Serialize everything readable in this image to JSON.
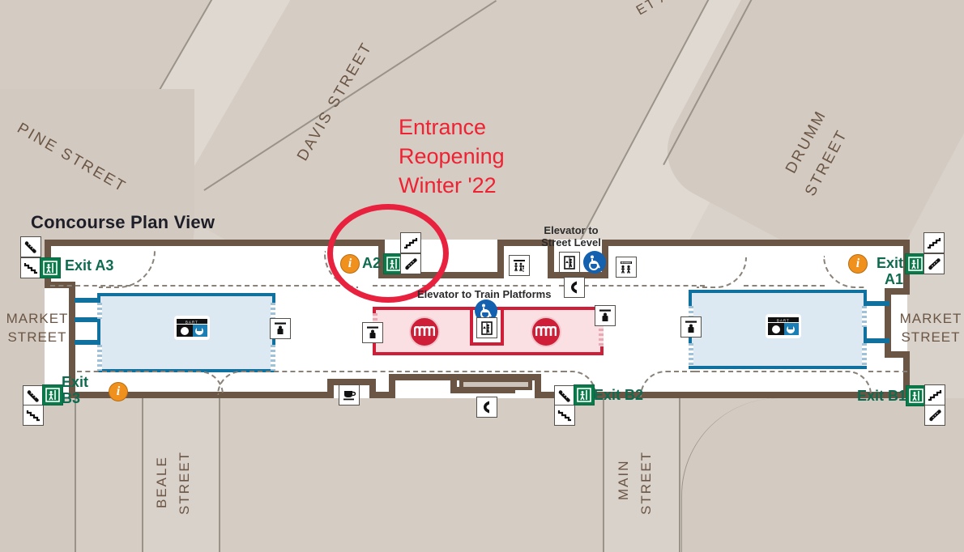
{
  "map": {
    "title": "Concourse Plan View",
    "alert": {
      "line1": "Entrance",
      "line2": "Reopening",
      "line3": "Winter '22",
      "color": "#ee2233"
    },
    "streets": [
      {
        "name": "PINE STREET",
        "text": "PINE  STREET"
      },
      {
        "name": "DAVIS STREET",
        "text": "DAVIS  STREET"
      },
      {
        "name": "DRUMM STREET",
        "text": "DRUMM"
      },
      {
        "name": "DRUMM STREET 2",
        "text": "STREET"
      },
      {
        "name": "BEALE STREET",
        "text": "BEALE"
      },
      {
        "name": "BEALE STREET 2",
        "text": "STREET"
      },
      {
        "name": "MAIN STREET",
        "text": "MAIN"
      },
      {
        "name": "MAIN STREET 2",
        "text": "STREET"
      },
      {
        "name": "MARKET STREET LEFT 1",
        "text": "MARKET"
      },
      {
        "name": "MARKET STREET LEFT 2",
        "text": "STREET"
      },
      {
        "name": "MARKET STREET RIGHT 1",
        "text": "MARKET"
      },
      {
        "name": "MARKET STREET RIGHT 2",
        "text": "STREET"
      },
      {
        "name": "CLIPPED TOP",
        "text": "ET  A"
      }
    ],
    "exits": [
      {
        "id": "A3",
        "label": "Exit A3"
      },
      {
        "id": "A2",
        "label": "A2"
      },
      {
        "id": "A1_l1",
        "label": "Exit"
      },
      {
        "id": "A1_l2",
        "label": "A1"
      },
      {
        "id": "B3_l1",
        "label": "Exit"
      },
      {
        "id": "B3_l2",
        "label": "B3"
      },
      {
        "id": "B2",
        "label": "Exit B2"
      },
      {
        "id": "B1",
        "label": "Exit B1"
      }
    ],
    "callouts": [
      {
        "id": "elev-street",
        "line1": "Elevator to",
        "line2": "Street Level"
      },
      {
        "id": "elev-platform",
        "line1": "Elevator to Train Platforms",
        "line2": ""
      }
    ],
    "logos": {
      "bart": "BART",
      "muni": "MUNI"
    },
    "icons": {
      "escalator": "escalator-icon",
      "stairs": "stairs-icon",
      "elevator": "elevator-icon",
      "restroom": "restroom-icon",
      "family_restroom": "family-restroom-icon",
      "payphone": "payphone-icon",
      "cafe": "cafe-icon",
      "ticket_vending": "ticket-vending-icon",
      "information": "information-icon",
      "accessible": "accessible-icon",
      "exit": "exit-person-icon"
    },
    "colors": {
      "bart_blue": "#10719e",
      "muni_red": "#cf1f38",
      "exit_green": "#0a7a4a",
      "info_orange": "#f0911e",
      "wall_brown": "#6b5544",
      "alert_red": "#ee2233"
    }
  }
}
